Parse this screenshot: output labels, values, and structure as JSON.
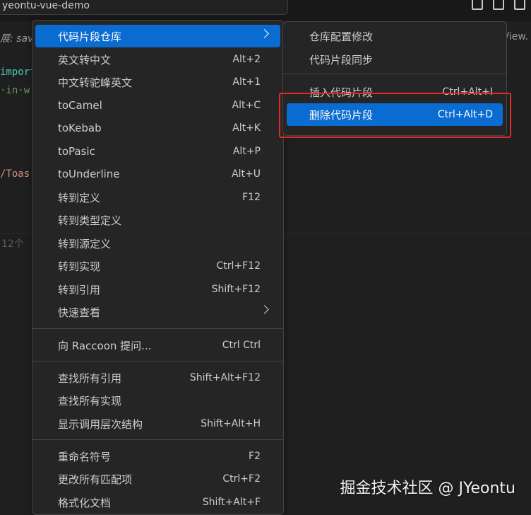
{
  "window": {
    "search_title": "yeontu-vue-demo"
  },
  "editor": {
    "ext_hint": "展: sav",
    "ext_hint_right": "View.",
    "code_lines": [
      {
        "text": "import",
        "color": "#4ec9b0"
      },
      {
        "text": "·in·w",
        "color": "#6a9955"
      },
      {
        "text": "/Toas",
        "color": "#ce9178"
      }
    ],
    "lines_hint": "12个"
  },
  "context_menu": {
    "items": [
      {
        "label": "代码片段仓库",
        "key": "",
        "submenu": true,
        "active": true
      },
      {
        "label": "英文转中文",
        "key": "Alt+2"
      },
      {
        "label": "中文转驼峰英文",
        "key": "Alt+1"
      },
      {
        "label": "toCamel",
        "key": "Alt+C"
      },
      {
        "label": "toKebab",
        "key": "Alt+K"
      },
      {
        "label": "toPasic",
        "key": "Alt+P"
      },
      {
        "label": "toUnderline",
        "key": "Alt+U"
      },
      {
        "label": "转到定义",
        "key": "F12"
      },
      {
        "label": "转到类型定义",
        "key": ""
      },
      {
        "label": "转到源定义",
        "key": ""
      },
      {
        "label": "转到实现",
        "key": "Ctrl+F12"
      },
      {
        "label": "转到引用",
        "key": "Shift+F12"
      },
      {
        "label": "快速查看",
        "key": "",
        "submenu": true
      },
      {
        "label": "向 Raccoon 提问...",
        "key": "Ctrl Ctrl"
      },
      {
        "label": "查找所有引用",
        "key": "Shift+Alt+F12"
      },
      {
        "label": "查找所有实现",
        "key": ""
      },
      {
        "label": "显示调用层次结构",
        "key": "Shift+Alt+H"
      },
      {
        "label": "重命名符号",
        "key": "F2"
      },
      {
        "label": "更改所有匹配项",
        "key": "Ctrl+F2"
      },
      {
        "label": "格式化文档",
        "key": "Shift+Alt+F"
      }
    ]
  },
  "submenu": {
    "items": [
      {
        "label": "仓库配置修改",
        "key": ""
      },
      {
        "label": "代码片段同步",
        "key": ""
      },
      {
        "label": "插入代码片段",
        "key": "Ctrl+Alt+I"
      },
      {
        "label": "删除代码片段",
        "key": "Ctrl+Alt+D",
        "active": true
      }
    ]
  },
  "watermark": "掘金技术社区 @ JYeontu",
  "colors": {
    "accent": "#0a6bd1",
    "highlight_box": "#e22a2a"
  }
}
